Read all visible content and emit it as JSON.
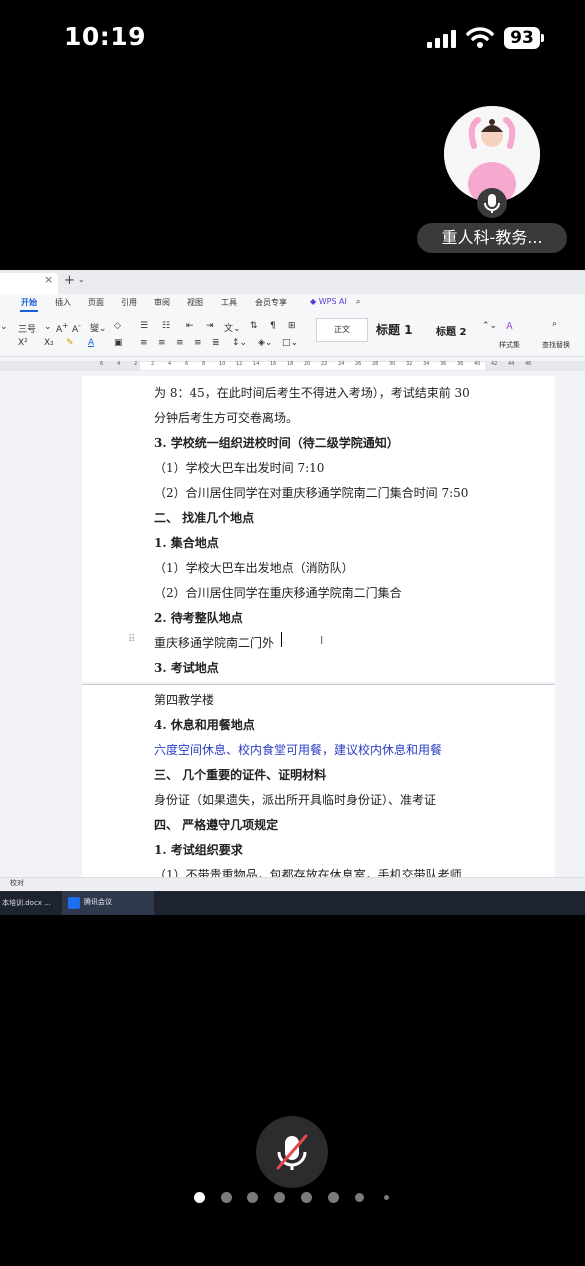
{
  "status_bar": {
    "time": "10:19",
    "battery": "93"
  },
  "participant": {
    "name": "重人科-教务..."
  },
  "wps": {
    "tab_close": "×",
    "tab_add": "+",
    "menu": [
      "开始",
      "插入",
      "页面",
      "引用",
      "审阅",
      "视图",
      "工具",
      "会员专享",
      "WPS AI"
    ],
    "active_menu": "开始",
    "ribbon": {
      "font_size": "三号",
      "style_normal": "正文",
      "style_h1": "标题 1",
      "style_h2": "标题 2",
      "styles_label": "样式集",
      "find_label": "查找替换"
    },
    "ruler_ticks": [
      "6",
      "4",
      "2",
      "2",
      "4",
      "6",
      "8",
      "10",
      "12",
      "14",
      "16",
      "18",
      "20",
      "22",
      "24",
      "26",
      "28",
      "30",
      "32",
      "34",
      "36",
      "38",
      "40",
      "42",
      "44",
      "46"
    ],
    "status_label": "校对"
  },
  "document": {
    "page1_lines": [
      {
        "text": "为 8：45，在此时间后考生不得进入考场），考试结束前 30",
        "style": "normal"
      },
      {
        "text": "分钟后考生方可交卷离场。",
        "style": "normal"
      },
      {
        "text": "3. 学校统一组织进校时间（待二级学院通知）",
        "style": "bold"
      },
      {
        "text": "（1）学校大巴车出发时间 7:10",
        "style": "normal"
      },
      {
        "text": "（2）合川居住同学在对重庆移通学院南二门集合时间 7:50",
        "style": "normal"
      },
      {
        "text": "二、 找准几个地点",
        "style": "bold"
      },
      {
        "text": "1. 集合地点",
        "style": "bold"
      },
      {
        "text": "（1）学校大巴车出发地点（消防队）",
        "style": "normal"
      },
      {
        "text": "（2）合川居住同学在重庆移通学院南二门集合",
        "style": "normal"
      },
      {
        "text": "2. 待考整队地点",
        "style": "bold"
      },
      {
        "text": "重庆移通学院南二门外",
        "style": "normal"
      },
      {
        "text": "3. 考试地点",
        "style": "bold"
      }
    ],
    "page2_lines": [
      {
        "text": "第四教学楼",
        "style": "normal"
      },
      {
        "text": "4. 休息和用餐地点",
        "style": "bold"
      },
      {
        "text": "六度空间休息、校内食堂可用餐，建议校内休息和用餐",
        "style": "blue"
      },
      {
        "text": "三、 几个重要的证件、证明材料",
        "style": "bold"
      },
      {
        "text": "身份证（如果遗失，派出所开具临时身份证）、准考证",
        "style": "normal"
      },
      {
        "text": "四、 严格遵守几项规定",
        "style": "bold"
      },
      {
        "text": "1. 考试组织要求",
        "style": "bold"
      },
      {
        "text": "（1）不带贵重物品，包都存放在休息室，手机交带队老师",
        "style": "normal"
      }
    ]
  },
  "taskbar": {
    "doc_item": "本培训.docx ...",
    "meeting_item": "腾讯会议"
  },
  "pager": {
    "count": 8,
    "active": 0
  }
}
